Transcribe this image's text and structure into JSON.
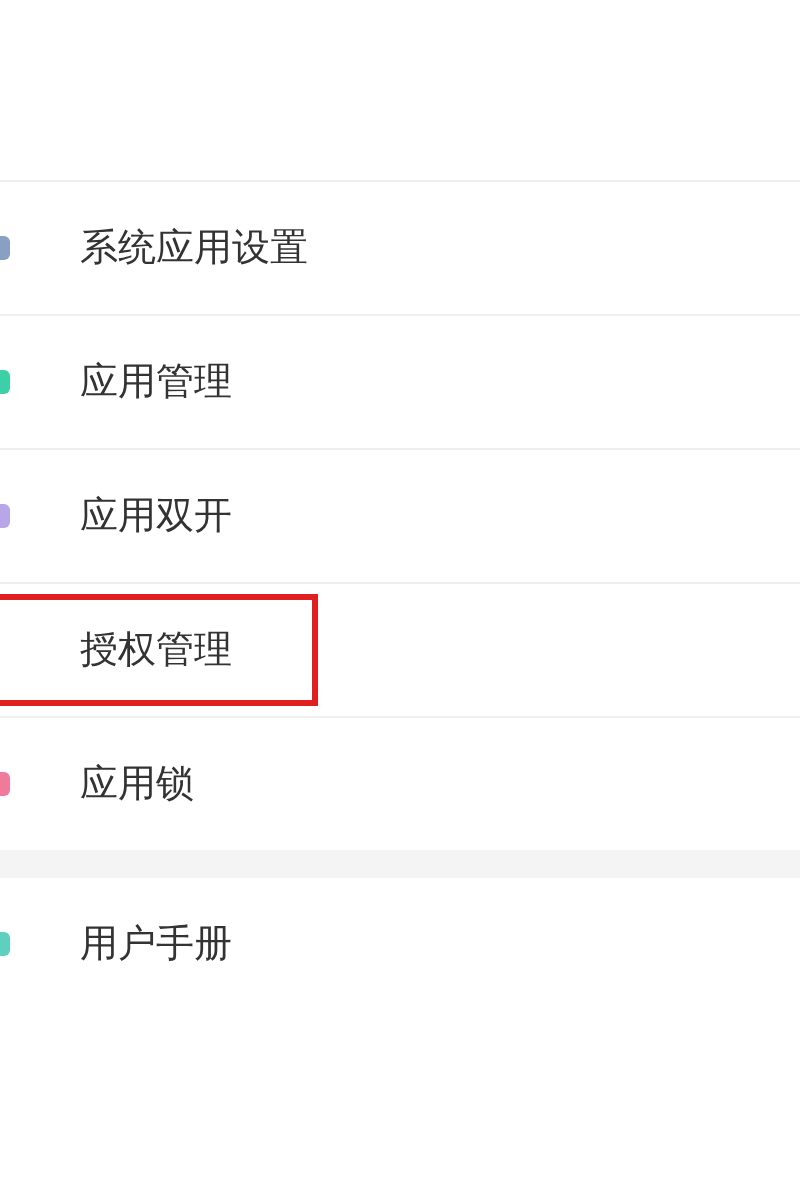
{
  "groups": [
    {
      "items": [
        {
          "label": "系统应用设置",
          "color": "#8aa0c0",
          "highlighted": false
        },
        {
          "label": "应用管理",
          "color": "#3ccfa8",
          "highlighted": false
        },
        {
          "label": "应用双开",
          "color": "#b8a6e8",
          "highlighted": false
        },
        {
          "label": "授权管理",
          "color": "#ffffff",
          "highlighted": true
        },
        {
          "label": "应用锁",
          "color": "#f07a9a",
          "highlighted": false
        }
      ]
    },
    {
      "items": [
        {
          "label": "用户手册",
          "color": "#5fd0c0",
          "highlighted": false
        }
      ]
    }
  ]
}
